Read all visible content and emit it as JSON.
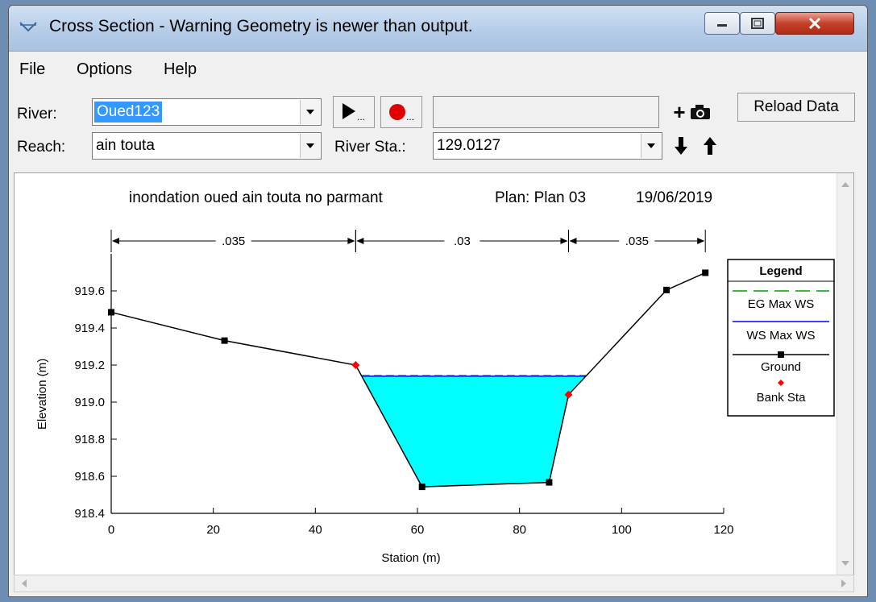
{
  "window": {
    "title": "Cross Section - Warning Geometry is newer than output."
  },
  "menu": [
    "File",
    "Options",
    "Help"
  ],
  "toolbar": {
    "river_label": "River:",
    "river_value": "Oued123",
    "reach_label": "Reach:",
    "reach_value": "ain touta",
    "river_sta_label": "River Sta.:",
    "river_sta_value": "129.0127",
    "reload_label": "Reload Data",
    "plus_label": "+",
    "play_suffix": "...",
    "record_suffix": "..."
  },
  "icons": {
    "title": "cross-section-app-icon",
    "play": "play-animation-icon",
    "record": "record-icon",
    "camera": "camera-icon",
    "down": "arrow-down-icon",
    "up": "arrow-up-icon"
  },
  "colors": {
    "water": "#00ffff",
    "ground": "#000000",
    "bank": "#ff0000",
    "eg_line": "#00a000",
    "ws_line": "#0000ff"
  },
  "chart_data": {
    "type": "line",
    "title": "inondation oued ain touta no parmant",
    "plan": "Plan: Plan 03",
    "date": "19/06/2019",
    "xlabel": "Station (m)",
    "ylabel": "Elevation (m)",
    "xlim": [
      0,
      120
    ],
    "ylim": [
      918.4,
      919.8
    ],
    "x_ticks": [
      0,
      20,
      40,
      60,
      80,
      100,
      120
    ],
    "y_ticks": [
      "918.4",
      "918.6",
      "918.8",
      "919.0",
      "919.2",
      "919.4",
      "919.6"
    ],
    "ground": {
      "x": [
        0,
        22.2,
        47.9,
        60.9,
        85.8,
        89.6,
        108.8,
        116.4
      ],
      "y": [
        919.485,
        919.332,
        919.2,
        918.543,
        918.567,
        919.04,
        919.605,
        919.698
      ]
    },
    "bank_sta": {
      "x": [
        47.9,
        89.6
      ],
      "y": [
        919.2,
        919.04
      ]
    },
    "ws_max": 919.14,
    "eg_max": 919.14,
    "mannings_n": [
      {
        "label": ".035",
        "from": 0,
        "to": 47.9
      },
      {
        "label": ".03",
        "from": 47.9,
        "to": 89.6
      },
      {
        "label": ".035",
        "from": 89.6,
        "to": 116.4
      }
    ],
    "legend": {
      "title": "Legend",
      "entries": [
        "EG Max WS",
        "WS Max WS",
        "Ground",
        "Bank Sta"
      ],
      "position": "right"
    }
  }
}
